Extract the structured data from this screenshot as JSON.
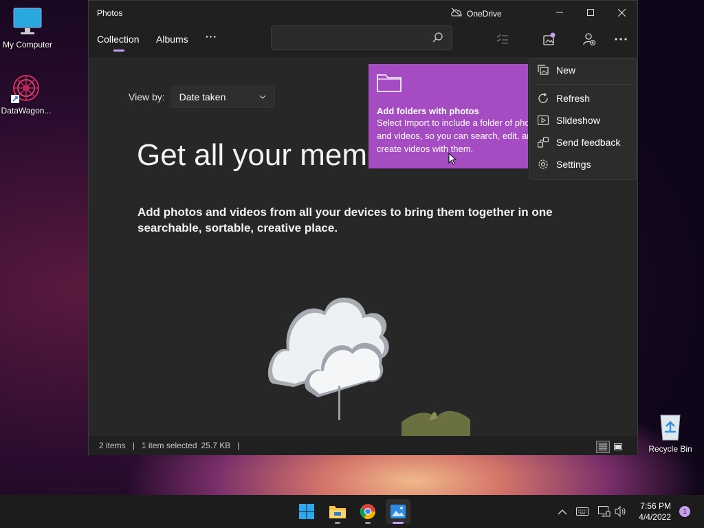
{
  "desktop": {
    "icons": [
      {
        "label": "My Computer",
        "icon": "monitor-icon"
      },
      {
        "label": "DataWagon...",
        "icon": "datawagon-icon"
      },
      {
        "label": "Recycle Bin",
        "icon": "recycle-bin-icon"
      }
    ]
  },
  "window": {
    "title": "Photos",
    "onedrive_label": "OneDrive",
    "controls": [
      "minimize",
      "maximize",
      "close"
    ]
  },
  "nav": {
    "tabs": [
      {
        "label": "Collection",
        "active": true
      },
      {
        "label": "Albums",
        "active": false
      }
    ],
    "more_label": "···",
    "search": {
      "placeholder": "",
      "value": ""
    }
  },
  "content": {
    "viewby_label": "View by:",
    "viewby_value": "Date taken",
    "headline": "Get all your memo",
    "subtitle": "Add photos and videos from all your devices to bring them together in one searchable, sortable, creative place."
  },
  "tip": {
    "title": "Add folders with photos",
    "body": "Select Import to include a folder of photos and videos, so you can search, edit, and create videos with them."
  },
  "menu": {
    "items": [
      {
        "label": "New",
        "icon": "new-photo-icon"
      },
      {
        "label": "Refresh",
        "icon": "refresh-icon"
      },
      {
        "label": "Slideshow",
        "icon": "slideshow-icon"
      },
      {
        "label": "Send feedback",
        "icon": "feedback-icon"
      },
      {
        "label": "Settings",
        "icon": "gear-icon"
      }
    ]
  },
  "status": {
    "items_count": "2 items",
    "selection": "1 item selected",
    "size": "25.7 KB"
  },
  "taskbar": {
    "apps": [
      "start-button",
      "file-explorer",
      "chrome",
      "photos"
    ],
    "time": "7:56 PM",
    "date": "4/4/2022",
    "notification_count": "1"
  },
  "colors": {
    "accent": "#a64cc2",
    "tab_indicator": "#c9a0f0"
  }
}
